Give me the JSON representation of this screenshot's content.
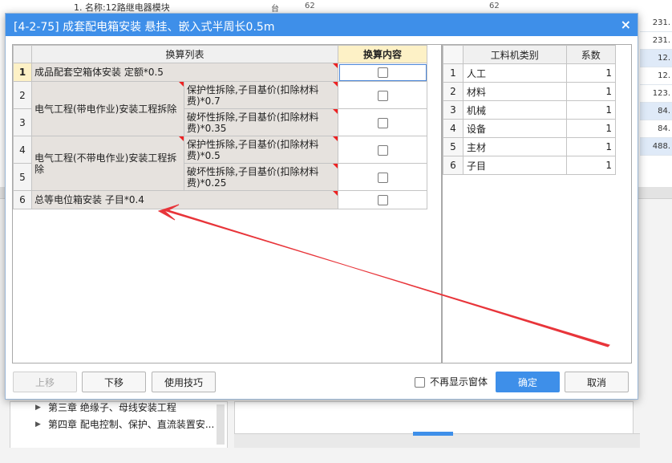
{
  "background": {
    "top_text": "1. 名称:12路继电器模块",
    "top_values": [
      "台",
      "62",
      "62"
    ],
    "right_values": [
      "231.",
      "231.",
      "12.",
      "12.",
      "123.",
      "84.",
      "84.",
      "488."
    ],
    "tree_items": [
      "第三章 绝缘子、母线安装工程",
      "第四章 配电控制、保护、直流装置安..."
    ]
  },
  "dialog": {
    "title": "[4-2-75] 成套配电箱安装 悬挂、嵌入式半周长0.5m",
    "close_glyph": "×",
    "left_table": {
      "col_list": "换算列表",
      "col_content": "换算内容",
      "rows": [
        {
          "num": "1",
          "text": "成品配套空箱体安装 定额*0.5"
        },
        {
          "num": "2",
          "group": "电气工程(带电作业)安装工程拆除",
          "text": "保护性拆除,子目基价(扣除材料费)*0.7"
        },
        {
          "num": "3",
          "text": "破坏性拆除,子目基价(扣除材料费)*0.35"
        },
        {
          "num": "4",
          "group": "电气工程(不带电作业)安装工程拆除",
          "text": "保护性拆除,子目基价(扣除材料费)*0.5"
        },
        {
          "num": "5",
          "text": "破坏性拆除,子目基价(扣除材料费)*0.25"
        },
        {
          "num": "6",
          "text": "总等电位箱安装 子目*0.4"
        }
      ]
    },
    "right_table": {
      "col_type": "工料机类别",
      "col_coef": "系数",
      "rows": [
        {
          "num": "1",
          "type": "人工",
          "coef": "1"
        },
        {
          "num": "2",
          "type": "材料",
          "coef": "1"
        },
        {
          "num": "3",
          "type": "机械",
          "coef": "1"
        },
        {
          "num": "4",
          "type": "设备",
          "coef": "1"
        },
        {
          "num": "5",
          "type": "主材",
          "coef": "1"
        },
        {
          "num": "6",
          "type": "子目",
          "coef": "1"
        }
      ]
    },
    "buttons": {
      "up": "上移",
      "down": "下移",
      "tips": "使用技巧",
      "no_show": "不再显示窗体",
      "ok": "确定",
      "cancel": "取消"
    },
    "colors": {
      "accent": "#3e8fe9",
      "annotation_arrow": "#e8353a"
    }
  }
}
